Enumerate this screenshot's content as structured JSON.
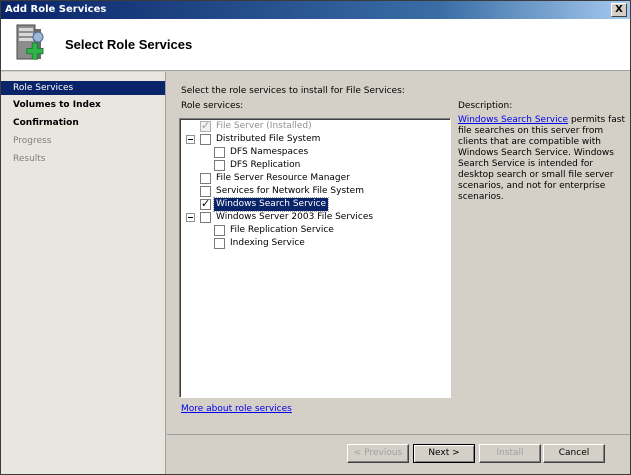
{
  "window": {
    "title": "Add Role Services",
    "close_glyph": "X"
  },
  "header": {
    "title": "Select Role Services",
    "icon": "server-add-icon"
  },
  "sidebar": {
    "steps": [
      {
        "label": "Role Services",
        "state": "active"
      },
      {
        "label": "Volumes to Index",
        "state": "bold"
      },
      {
        "label": "Confirmation",
        "state": "bold"
      },
      {
        "label": "Progress",
        "state": "dim"
      },
      {
        "label": "Results",
        "state": "dim"
      }
    ]
  },
  "main": {
    "prompt": "Select the role services to install for File Services:",
    "role_services_label": "Role services:",
    "tree": [
      {
        "label": "File Server  (Installed)",
        "checked": true,
        "disabled": true,
        "expander": false,
        "level": 0
      },
      {
        "label": "Distributed File System",
        "checked": false,
        "expander": true,
        "level": 0
      },
      {
        "label": "DFS Namespaces",
        "checked": false,
        "expander": false,
        "level": 1
      },
      {
        "label": "DFS Replication",
        "checked": false,
        "expander": false,
        "level": 1
      },
      {
        "label": "File Server Resource Manager",
        "checked": false,
        "expander": false,
        "level": 0
      },
      {
        "label": "Services for Network File System",
        "checked": false,
        "expander": false,
        "level": 0
      },
      {
        "label": "Windows Search Service",
        "checked": true,
        "selected": true,
        "expander": false,
        "level": 0
      },
      {
        "label": "Windows Server 2003 File Services",
        "checked": false,
        "expander": true,
        "level": 0
      },
      {
        "label": "File Replication Service",
        "checked": false,
        "expander": false,
        "level": 1
      },
      {
        "label": "Indexing Service",
        "checked": false,
        "expander": false,
        "level": 1
      }
    ],
    "description_title": "Description:",
    "description_link": "Windows Search Service",
    "description_text": " permits fast file searches on this server from clients that are compatible with Windows Search Service. Windows Search Service is intended for desktop search or small file server scenarios, and not for enterprise scenarios.",
    "more_link": "More about role services"
  },
  "footer": {
    "previous": "< Previous",
    "next": "Next >",
    "install": "Install",
    "cancel": "Cancel"
  }
}
